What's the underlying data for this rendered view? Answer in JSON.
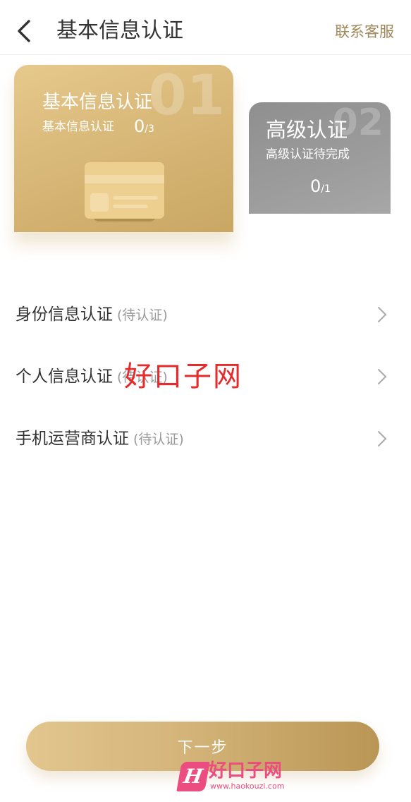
{
  "header": {
    "title": "基本信息认证",
    "service_label": "联系客服"
  },
  "cards": {
    "basic": {
      "number": "01",
      "title": "基本信息认证",
      "subtitle": "基本信息认证",
      "done": "0",
      "total": "/3"
    },
    "advanced": {
      "number": "02",
      "title": "高级认证",
      "subtitle": "高级认证待完成",
      "done": "0",
      "total": "/1"
    }
  },
  "list": {
    "items": [
      {
        "label": "身份信息认证",
        "status": "(待认证)"
      },
      {
        "label": "个人信息认证",
        "status": "(待认证)"
      },
      {
        "label": "手机运营商认证",
        "status": "(待认证)"
      }
    ]
  },
  "footer": {
    "next_label": "下一步"
  },
  "watermark": {
    "center_text": "好口子网",
    "bottom_text": "好口子网",
    "bottom_url": "www.haokouzi.com"
  },
  "colors": {
    "accent_gold": "#c9a763",
    "service_text": "#a0875a",
    "card_inactive": "#9c9c9c",
    "watermark_red": "#e52b2b"
  }
}
